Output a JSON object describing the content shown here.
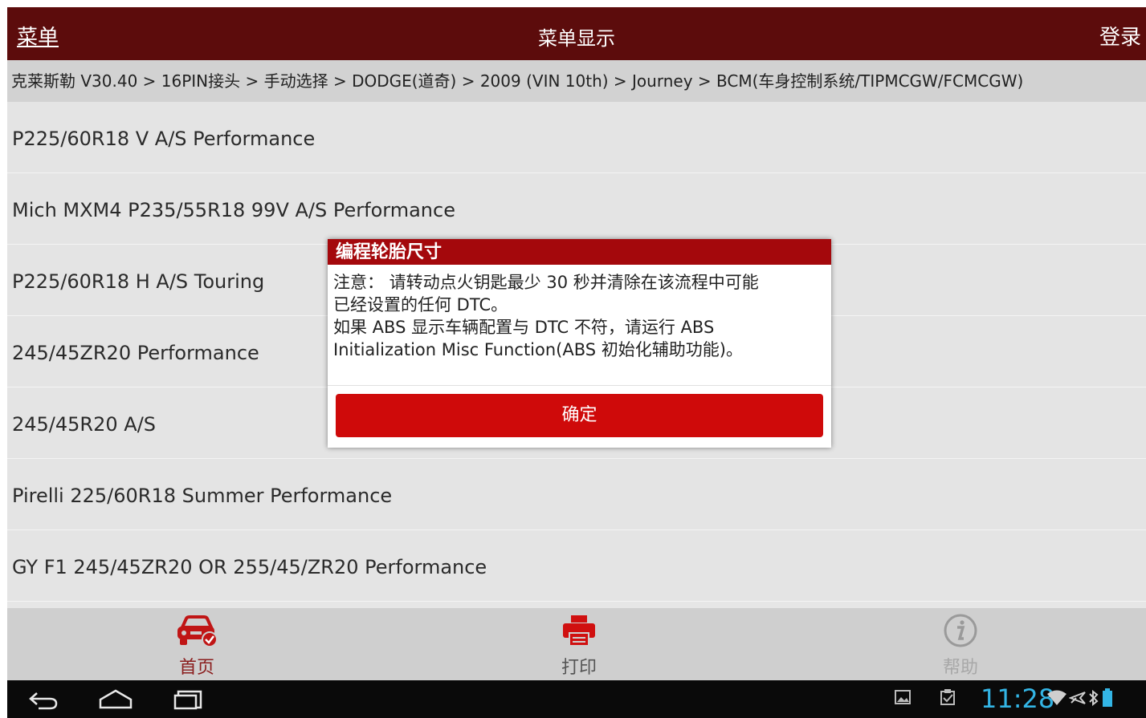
{
  "header": {
    "menu_label": "菜单",
    "title": "菜单显示",
    "login_label": "登录"
  },
  "breadcrumb": "克莱斯勒 V30.40 > 16PIN接头 > 手动选择 > DODGE(道奇) > 2009 (VIN 10th) > Journey > BCM(车身控制系统/TIPMCGW/FCMCGW)",
  "list": {
    "items": [
      "P225/60R18 V A/S Performance",
      "Mich MXM4 P235/55R18 99V A/S Performance",
      "P225/60R18 H A/S Touring",
      "245/45ZR20 Performance",
      "245/45R20 A/S",
      "Pirelli 225/60R18 Summer Performance",
      "GY F1 245/45ZR20 OR 255/45/ZR20 Performance"
    ]
  },
  "dialog": {
    "title": "编程轮胎尺寸",
    "message": "注意： 请转动点火钥匙最少 30 秒并清除在该流程中可能\n已经设置的任何 DTC。\n 如果 ABS 显示车辆配置与 DTC 不符，请运行 ABS\nInitialization Misc Function(ABS 初始化辅助功能)。",
    "ok_label": "确定"
  },
  "toolbar": {
    "home_label": "首页",
    "print_label": "打印",
    "help_label": "帮助"
  },
  "statusbar": {
    "time": "11:28"
  },
  "colors": {
    "header_bg": "#5c0c0c",
    "dialog_title_bg": "#a4080c",
    "button_bg": "#cf0a0a",
    "clock": "#33b5e5"
  },
  "icons": {
    "home": "car-check-icon",
    "print": "printer-icon",
    "help": "info-icon",
    "back": "back-icon",
    "home_nav": "home-nav-icon",
    "recents": "recents-icon"
  }
}
